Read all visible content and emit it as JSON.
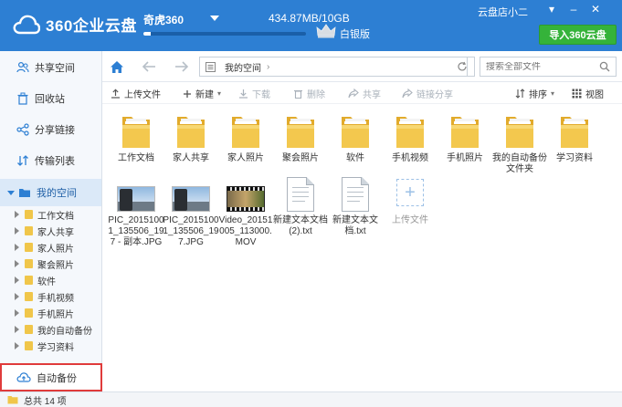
{
  "app": {
    "logo_text": "360企业云盘",
    "brand_color": "#2d7fd3"
  },
  "header": {
    "account_name": "奇虎360",
    "quota_text": "434.87MB/10GB",
    "quota_fraction": 0.0425,
    "tier_label": "白银版",
    "shop_name": "云盘店小二",
    "import_button": "导入360云盘",
    "window_controls": {
      "menu": "▾",
      "minimize": "–",
      "close": "✕"
    }
  },
  "sidebar": {
    "items": [
      {
        "label": "共享空间",
        "icon": "people-icon"
      },
      {
        "label": "回收站",
        "icon": "trash-icon"
      },
      {
        "label": "分享链接",
        "icon": "share-icon"
      },
      {
        "label": "传输列表",
        "icon": "transfer-icon"
      }
    ],
    "my_space": {
      "label": "我的空间",
      "icon": "folder-icon"
    },
    "tree": [
      "工作文档",
      "家人共享",
      "家人照片",
      "聚会照片",
      "软件",
      "手机视频",
      "手机照片",
      "我的自动备份",
      "学习资料"
    ],
    "auto_backup": "自动备份"
  },
  "addressbar": {
    "breadcrumb": "我的空间",
    "breadcrumb_arrow": "›",
    "search_placeholder": "搜索全部文件"
  },
  "toolbar": {
    "upload": "上传文件",
    "new": "新建",
    "download": "下载",
    "delete": "删除",
    "share": "共享",
    "link_share": "链接分享",
    "sort": "排序",
    "view": "视图"
  },
  "files": {
    "folders": [
      "工作文档",
      "家人共享",
      "家人照片",
      "聚会照片",
      "软件",
      "手机视频",
      "手机照片",
      "我的自动备份文件夹",
      "学习资料"
    ],
    "items": [
      {
        "name": "PIC_20151001_135506_197 - 副本.JPG",
        "kind": "photo"
      },
      {
        "name": "PIC_20151001_135506_197.JPG",
        "kind": "photo"
      },
      {
        "name": "Video_20151005_113000.MOV",
        "kind": "video"
      },
      {
        "name": "新建文本文档 (2).txt",
        "kind": "doc"
      },
      {
        "name": "新建文本文档.txt",
        "kind": "doc"
      }
    ],
    "upload_tile": "上传文件"
  },
  "status": {
    "total": "总共 14 项"
  }
}
